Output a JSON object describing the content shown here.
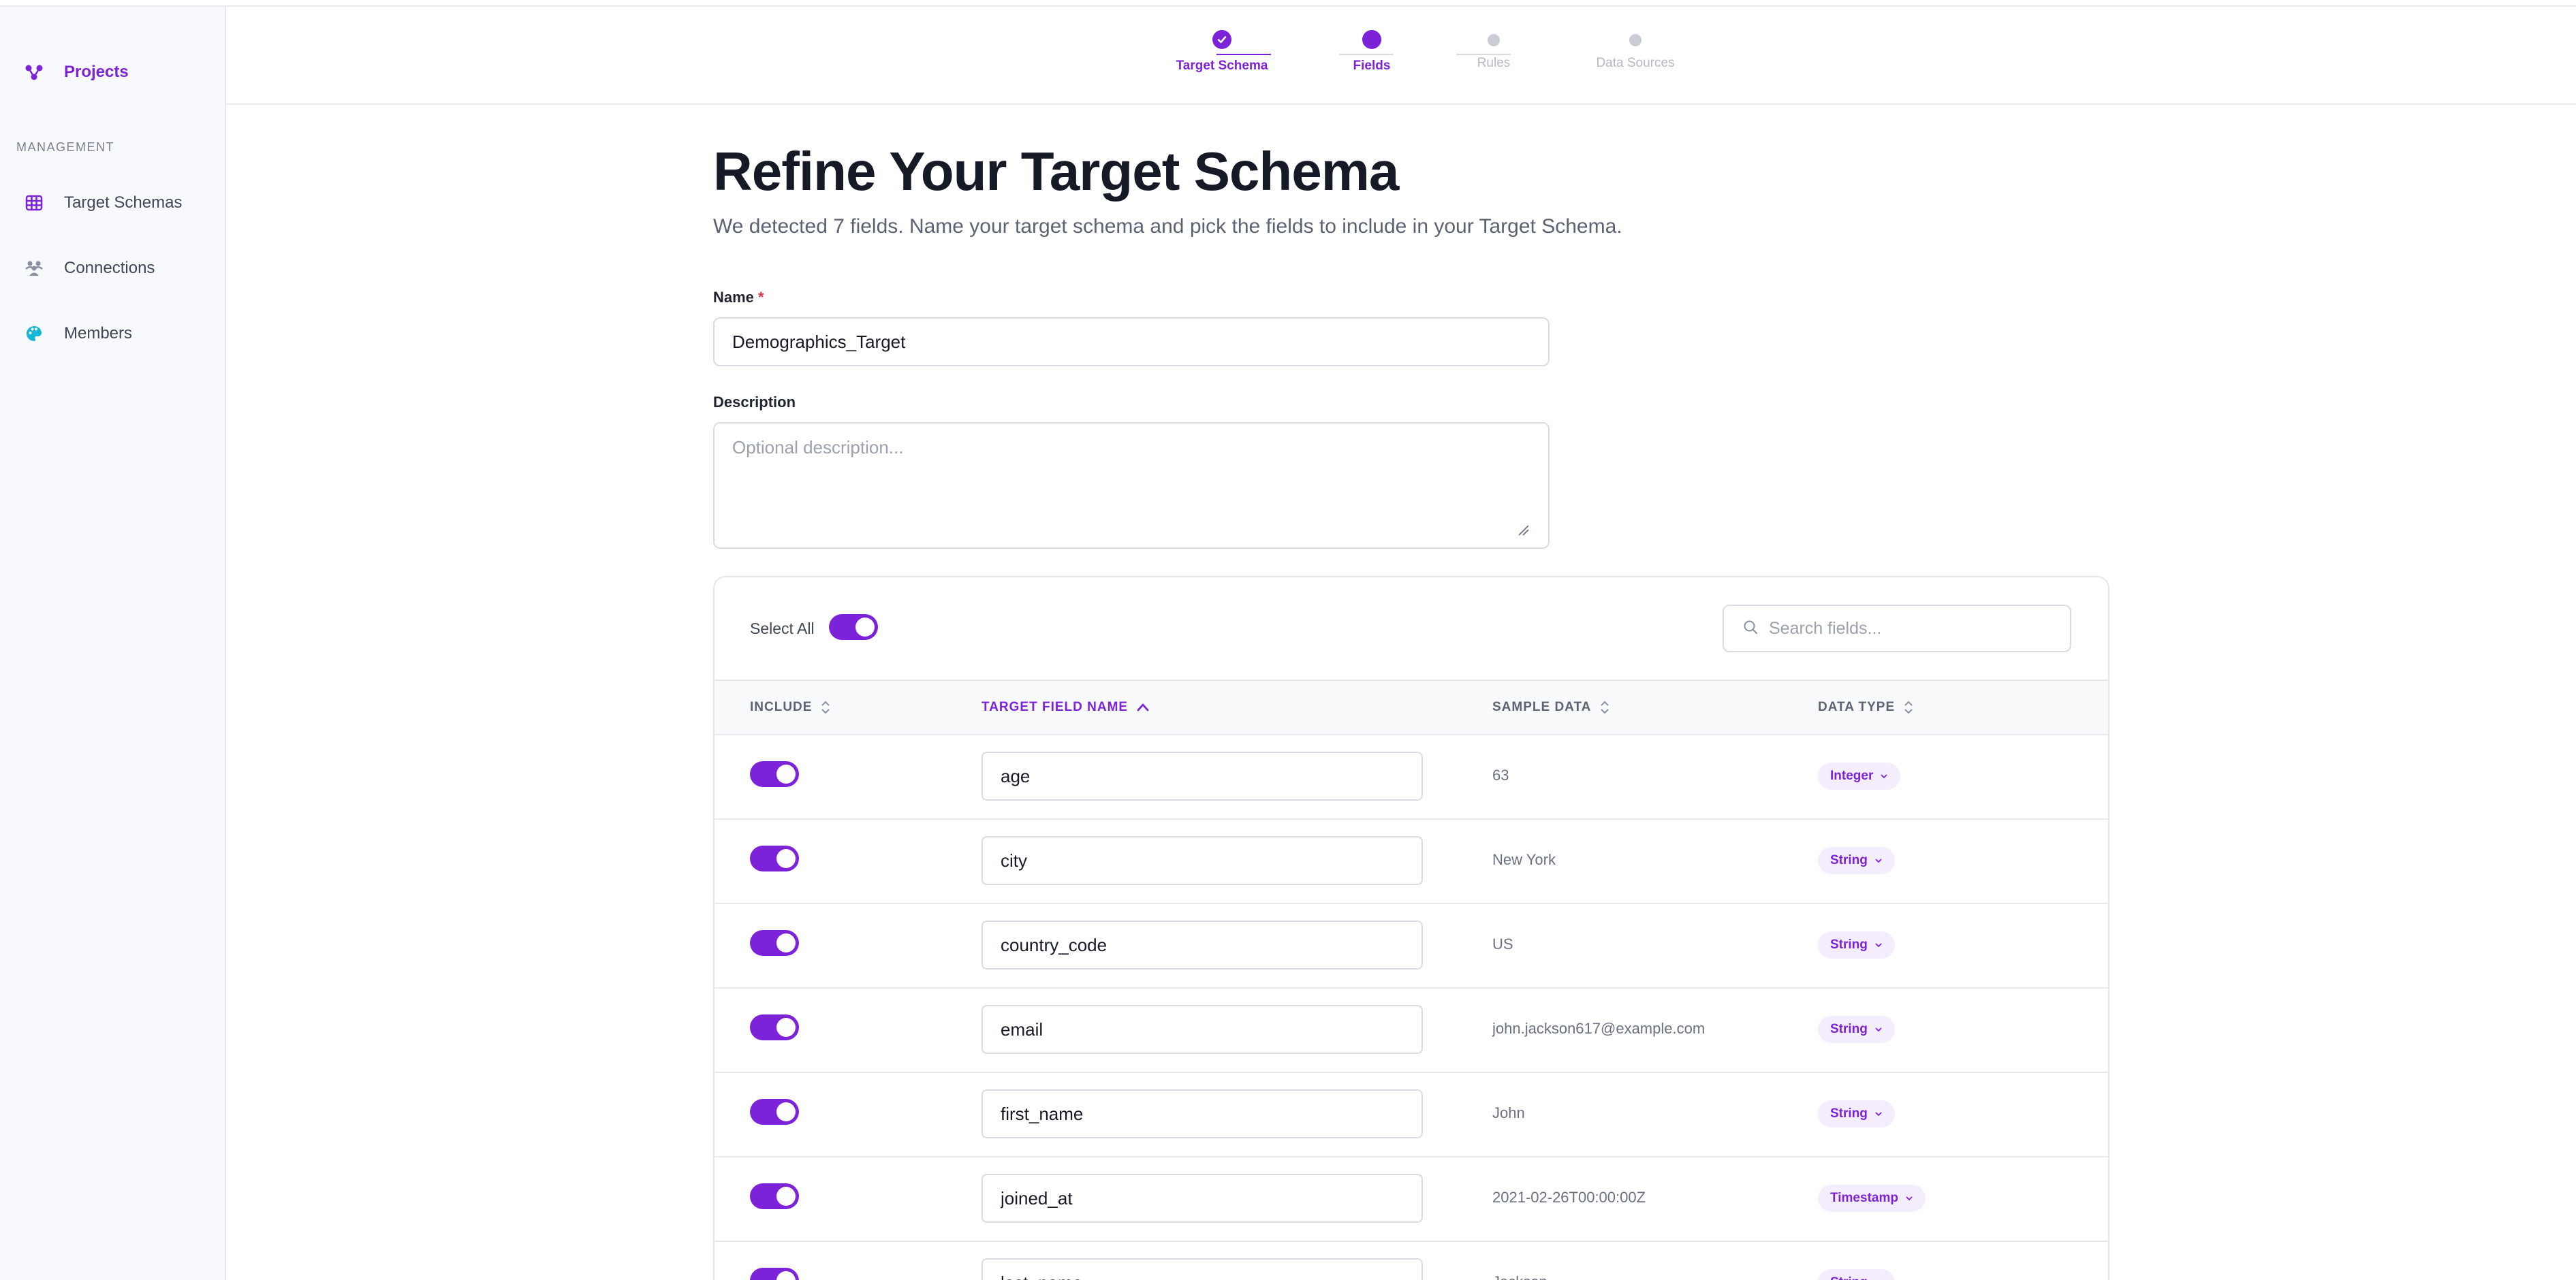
{
  "sidebar": {
    "projects_label": "Projects",
    "section_label": "MANAGEMENT",
    "items": [
      {
        "label": "Target Schemas",
        "icon": "grid-icon"
      },
      {
        "label": "Connections",
        "icon": "people-icon"
      },
      {
        "label": "Members",
        "icon": "palette-icon"
      }
    ]
  },
  "stepper": {
    "steps": [
      {
        "label": "Target Schema",
        "state": "done"
      },
      {
        "label": "Fields",
        "state": "current"
      },
      {
        "label": "Rules",
        "state": "pending"
      },
      {
        "label": "Data Sources",
        "state": "pending"
      }
    ]
  },
  "page": {
    "title": "Refine Your Target Schema",
    "subtitle": "We detected 7 fields. Name your target schema and pick the fields to include in your Target Schema."
  },
  "form": {
    "name_label": "Name",
    "name_required_mark": "*",
    "name_value": "Demographics_Target",
    "description_label": "Description",
    "description_placeholder": "Optional description..."
  },
  "fields_table": {
    "select_all_label": "Select All",
    "select_all_on": true,
    "search_placeholder": "Search fields...",
    "columns": {
      "include": "INCLUDE",
      "target_field_name": "TARGET FIELD NAME",
      "sample_data": "SAMPLE DATA",
      "data_type": "DATA TYPE"
    },
    "sorted_column": "target_field_name",
    "rows": [
      {
        "include": true,
        "name": "age",
        "sample": "63",
        "type": "Integer"
      },
      {
        "include": true,
        "name": "city",
        "sample": "New York",
        "type": "String"
      },
      {
        "include": true,
        "name": "country_code",
        "sample": "US",
        "type": "String"
      },
      {
        "include": true,
        "name": "email",
        "sample": "john.jackson617@example.com",
        "type": "String"
      },
      {
        "include": true,
        "name": "first_name",
        "sample": "John",
        "type": "String"
      },
      {
        "include": true,
        "name": "joined_at",
        "sample": "2021-02-26T00:00:00Z",
        "type": "Timestamp"
      },
      {
        "include": true,
        "name": "last_name",
        "sample": "Jackson",
        "type": "String"
      }
    ]
  },
  "colors": {
    "accent": "#7c22d8",
    "accent_soft": "#f3edfd",
    "members_icon": "#14b8d6",
    "required": "#e0364b"
  }
}
